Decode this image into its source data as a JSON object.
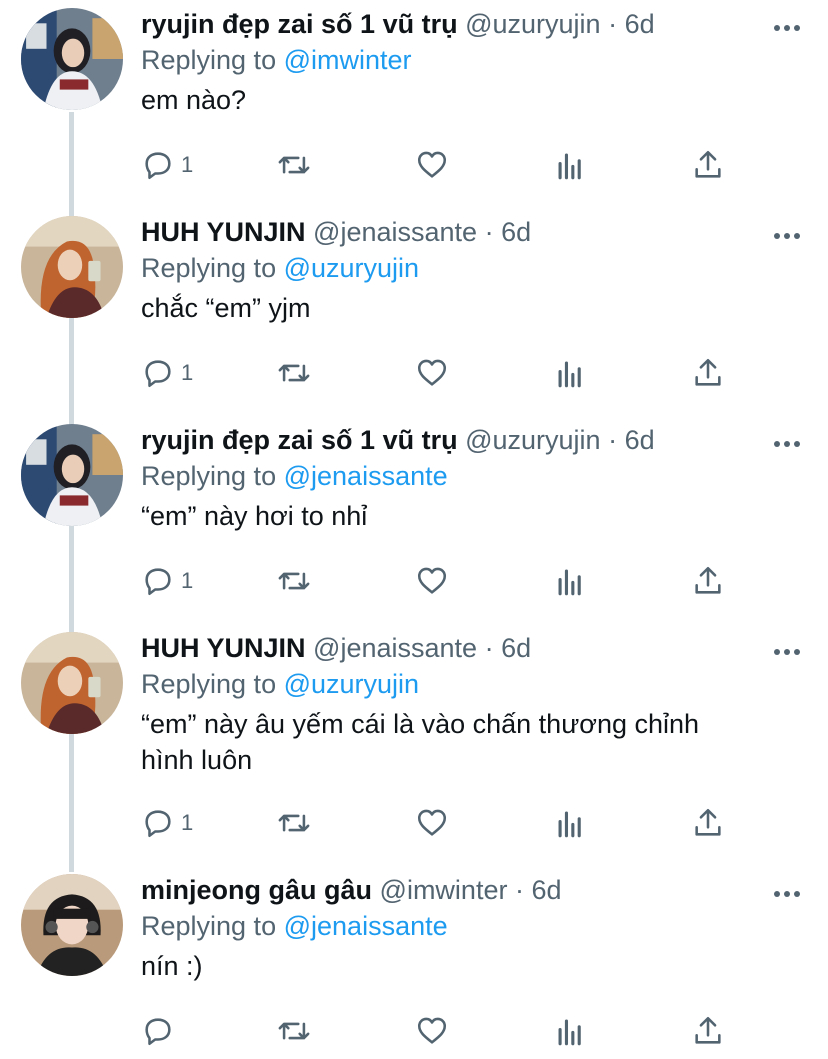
{
  "tweets": [
    {
      "name": "ryujin đẹp zai số 1 vũ trụ",
      "handle": "@uzuryujin",
      "dot": "·",
      "time": "6d",
      "reply_prefix": "Replying to",
      "reply_to": "@imwinter",
      "text_lines": [
        "em nào?"
      ],
      "reply_count": "1"
    },
    {
      "name": "HUH YUNJIN",
      "handle": "@jenaissante",
      "dot": "·",
      "time": "6d",
      "reply_prefix": "Replying to",
      "reply_to": "@uzuryujin",
      "text_lines": [
        "chắc “em” yjm"
      ],
      "reply_count": "1"
    },
    {
      "name": "ryujin đẹp zai số 1 vũ trụ",
      "handle": "@uzuryujin",
      "dot": "·",
      "time": "6d",
      "reply_prefix": "Replying to",
      "reply_to": "@jenaissante",
      "text_lines": [
        "“em” này hơi to nhỉ"
      ],
      "reply_count": "1"
    },
    {
      "name": "HUH YUNJIN",
      "handle": "@jenaissante",
      "dot": "·",
      "time": "6d",
      "reply_prefix": "Replying to",
      "reply_to": "@uzuryujin",
      "text_lines": [
        "“em” này âu yếm cái là vào chấn thương chỉnh",
        "hình luôn"
      ],
      "reply_count": "1"
    },
    {
      "name": "minjeong gâu gâu",
      "handle": "@imwinter",
      "dot": "·",
      "time": "6d",
      "reply_prefix": "Replying to",
      "reply_to": "@jenaissante",
      "text_lines": [
        "nín :)"
      ],
      "reply_count": ""
    }
  ],
  "colors": {
    "text": "#0f1419",
    "secondary": "#536471",
    "link": "#1d9bf0",
    "thread_line": "#cfd9de"
  },
  "icons": [
    "reply-icon",
    "retweet-icon",
    "like-icon",
    "analytics-icon",
    "share-icon",
    "more-icon"
  ]
}
